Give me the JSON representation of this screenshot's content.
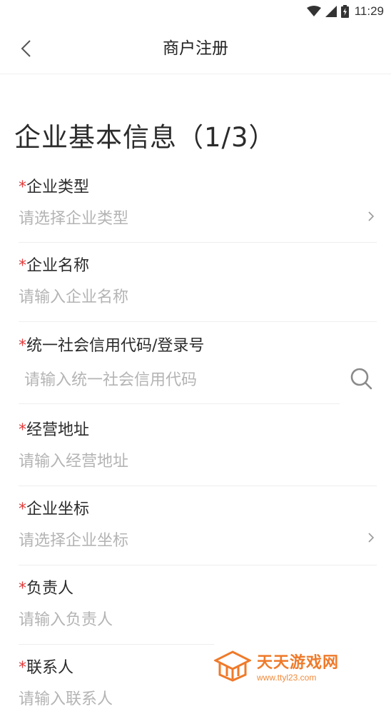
{
  "status_bar": {
    "time": "11:29"
  },
  "header": {
    "title": "商户注册"
  },
  "page_heading": "企业基本信息（1/3）",
  "required_mark": "*",
  "fields": [
    {
      "label": "企业类型",
      "placeholder": "请选择企业类型",
      "trailing": "chevron-right-icon"
    },
    {
      "label": "企业名称",
      "placeholder": "请输入企业名称"
    },
    {
      "label": "统一社会信用代码/登录号",
      "placeholder": "请输入统一社会信用代码",
      "trailing": "search-icon"
    },
    {
      "label": "经营地址",
      "placeholder": "请输入经营地址"
    },
    {
      "label": "企业坐标",
      "placeholder": "请选择企业坐标",
      "trailing": "chevron-right-icon"
    },
    {
      "label": "负责人",
      "placeholder": "请输入负责人"
    },
    {
      "label": "联系人",
      "placeholder": "请输入联系人"
    }
  ],
  "watermark": {
    "name": "天天游戏网",
    "url": "www.ttyl23.com"
  },
  "colors": {
    "required": "#e23b3b",
    "placeholder": "#b4b4b4",
    "watermark": "#ef7a2a"
  }
}
